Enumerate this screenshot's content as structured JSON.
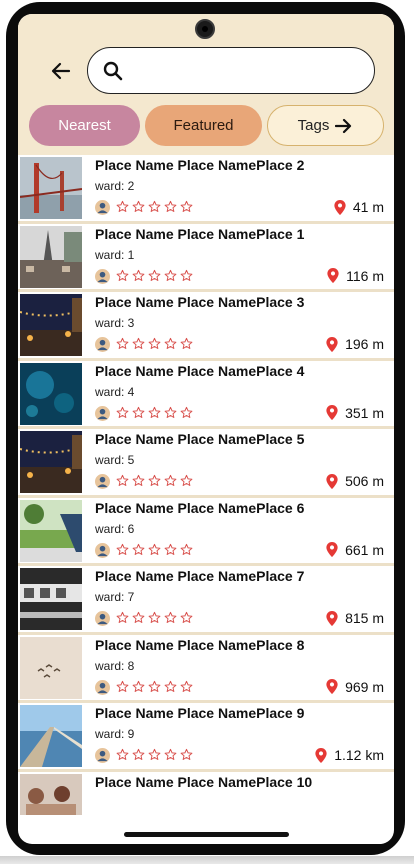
{
  "search": {
    "placeholder": ""
  },
  "filters": {
    "nearest": "Nearest",
    "featured": "Featured",
    "tags": "Tags"
  },
  "colors": {
    "header_bg": "#f4e8cf",
    "nearest": "#c7869f",
    "featured": "#e8a678",
    "star": "#d9534f",
    "pin": "#e53935"
  },
  "places": [
    {
      "title": "Place Name Place NamePlace 2",
      "ward": "ward: 2",
      "distance": "41 m",
      "rating": 0,
      "image": "bridge-photo"
    },
    {
      "title": "Place Name Place NamePlace 1",
      "ward": "ward: 1",
      "distance": "116 m",
      "rating": 0,
      "image": "tower-photo"
    },
    {
      "title": "Place Name Place NamePlace 3",
      "ward": "ward: 3",
      "distance": "196 m",
      "rating": 0,
      "image": "night-street-photo"
    },
    {
      "title": "Place Name Place NamePlace 4",
      "ward": "ward: 4",
      "distance": "351 m",
      "rating": 0,
      "image": "underwater-photo"
    },
    {
      "title": "Place Name Place NamePlace 5",
      "ward": "ward: 5",
      "distance": "506 m",
      "rating": 0,
      "image": "night-street-photo"
    },
    {
      "title": "Place Name Place NamePlace 6",
      "ward": "ward: 6",
      "distance": "661 m",
      "rating": 0,
      "image": "park-photo"
    },
    {
      "title": "Place Name Place NamePlace 7",
      "ward": "ward: 7",
      "distance": "815 m",
      "rating": 0,
      "image": "subway-photo"
    },
    {
      "title": "Place Name Place NamePlace 8",
      "ward": "ward: 8",
      "distance": "969 m",
      "rating": 0,
      "image": "birds-photo"
    },
    {
      "title": "Place Name Place NamePlace 9",
      "ward": "ward: 9",
      "distance": "1.12 km",
      "rating": 0,
      "image": "pier-photo"
    },
    {
      "title": "Place Name Place NamePlace 10",
      "ward": "",
      "distance": "",
      "rating": 0,
      "image": "people-photo"
    }
  ]
}
